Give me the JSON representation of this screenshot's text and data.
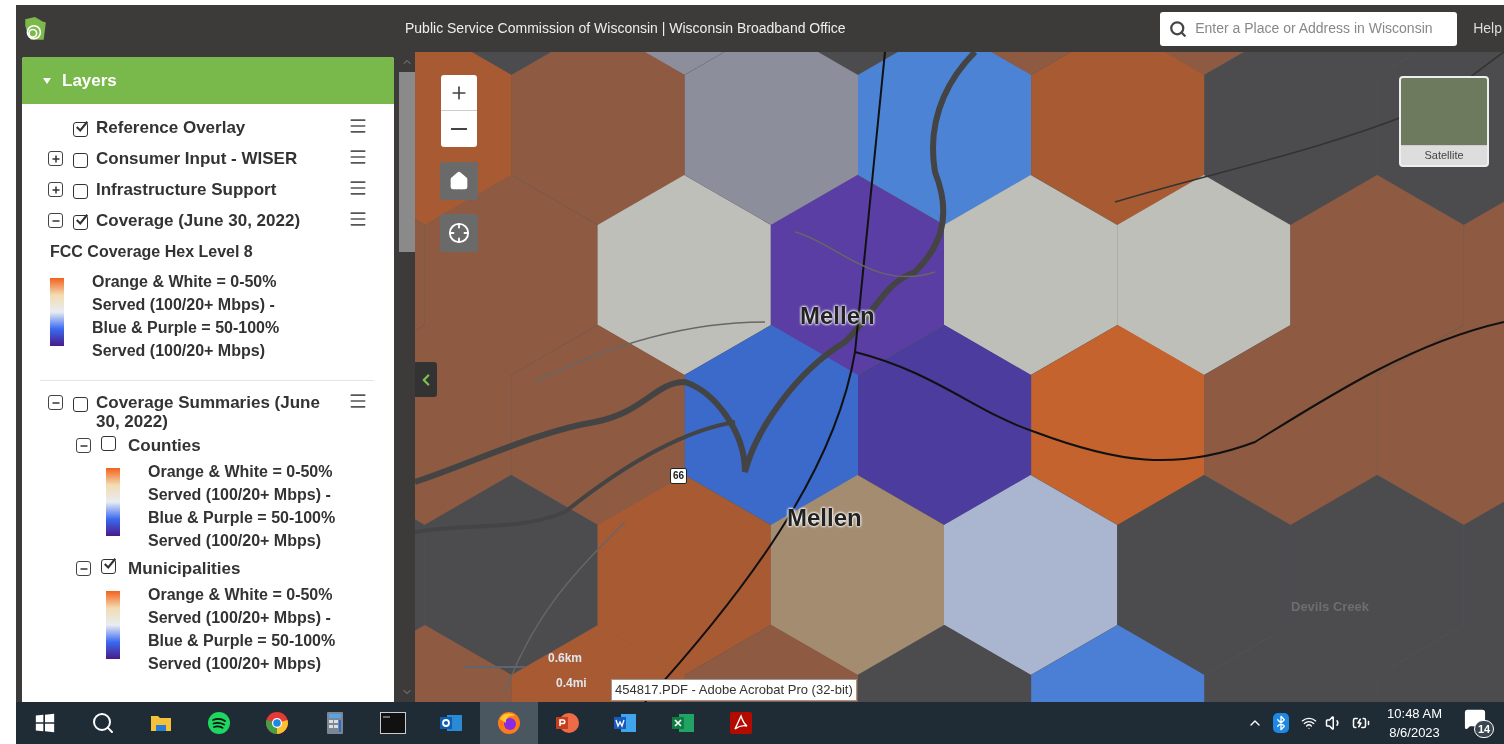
{
  "header": {
    "title": "Public Service Commission of Wisconsin | Wisconsin Broadband Office",
    "search": {
      "placeholder": "Enter a Place or Address in Wisconsin"
    },
    "help": "Help"
  },
  "sidebar": {
    "panel_title": "Layers",
    "expanded": true,
    "layers": [
      {
        "kind": "layer",
        "label": "Reference Overlay",
        "checked": true
      },
      {
        "kind": "group",
        "label": "Consumer Input - WISER",
        "checked": false,
        "expanded": false
      },
      {
        "kind": "group",
        "label": "Infrastructure Support",
        "checked": false,
        "expanded": false
      },
      {
        "kind": "group",
        "label": "Coverage (June 30, 2022)",
        "checked": true,
        "expanded": true,
        "legend": {
          "title": "FCC Coverage Hex Level 8",
          "lines": [
            "Orange & White = 0-50%",
            "Served (100/20+ Mbps) -",
            "Blue & Purple = 50-100%",
            "Served (100/20+ Mbps)"
          ]
        }
      },
      {
        "kind": "group",
        "label": "Coverage Summaries (June 30, 2022)",
        "checked": false,
        "expanded": true,
        "divider_before": true,
        "children": [
          {
            "label": "Counties",
            "checked": false,
            "expanded": true,
            "legend": {
              "lines": [
                "Orange & White = 0-50%",
                "Served (100/20+ Mbps) -",
                "Blue & Purple = 50-100%",
                "Served (100/20+ Mbps)"
              ]
            }
          },
          {
            "label": "Municipalities",
            "checked": true,
            "expanded": true,
            "legend": {
              "lines": [
                "Orange & White = 0-50%",
                "Served (100/20+ Mbps) -",
                "Blue & Purple = 50-100%",
                "Served (100/20+ Mbps)"
              ]
            }
          }
        ]
      }
    ]
  },
  "map": {
    "basemap_label": "Satellite",
    "labels": [
      {
        "kind": "city",
        "text": "Mellen"
      },
      {
        "kind": "city",
        "text": "Mellen"
      },
      {
        "kind": "creek",
        "text": "Devils Creek"
      },
      {
        "kind": "route",
        "text": "66"
      }
    ],
    "scale": {
      "metric": "0.6km",
      "imperial": "0.4mi"
    },
    "tooltip": "454817.PDF - Adobe Acrobat Pro (32-bit)"
  },
  "taskbar": {
    "apps": [
      {
        "kind": "start",
        "selected": false
      },
      {
        "kind": "search",
        "selected": false
      },
      {
        "kind": "files",
        "selected": false
      },
      {
        "kind": "music",
        "selected": false
      },
      {
        "kind": "chrome",
        "selected": false
      },
      {
        "kind": "calculator",
        "selected": false
      },
      {
        "kind": "terminal",
        "selected": false
      },
      {
        "kind": "outlook",
        "selected": false
      },
      {
        "kind": "firefox",
        "selected": true
      },
      {
        "kind": "powerpoint",
        "selected": false
      },
      {
        "kind": "word",
        "selected": false
      },
      {
        "kind": "excel",
        "selected": false
      },
      {
        "kind": "acrobat",
        "selected": false
      }
    ],
    "time": "10:48 AM",
    "date": "8/6/2023",
    "notifications": "14"
  }
}
